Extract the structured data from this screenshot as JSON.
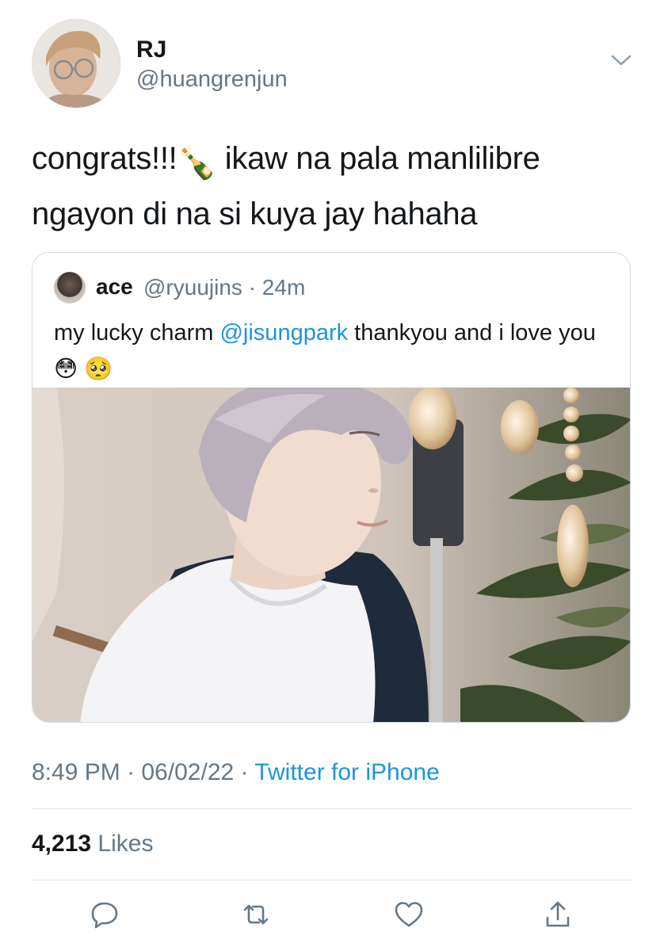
{
  "author": {
    "display_name": "RJ",
    "handle": "@huangrenjun"
  },
  "tweet": {
    "text_part1": "congrats!!!",
    "emoji1": "🍾",
    "text_part2": " ikaw na pala manlilibre ngayon di na si kuya jay hahaha"
  },
  "quote": {
    "name": "ace",
    "handle": "@ryuujins",
    "separator": "·",
    "age": "24m",
    "text_before": "my lucky charm ",
    "mention": "@jisungpark",
    "text_after": " thankyou and i love you",
    "emoji_a": "😳",
    "emoji_b": "🥺"
  },
  "meta": {
    "time": "8:49 PM",
    "sep": "·",
    "date": "06/02/22",
    "source": "Twitter for iPhone"
  },
  "stats": {
    "likes_count": "4,213",
    "likes_label": "Likes"
  },
  "icons": [
    "chevron-down-icon",
    "reply-icon",
    "retweet-icon",
    "like-icon",
    "share-icon"
  ],
  "colors": {
    "link": "#1b95e0",
    "secondary": "#657786",
    "text": "#14171a",
    "border": "#e1e8ed"
  }
}
